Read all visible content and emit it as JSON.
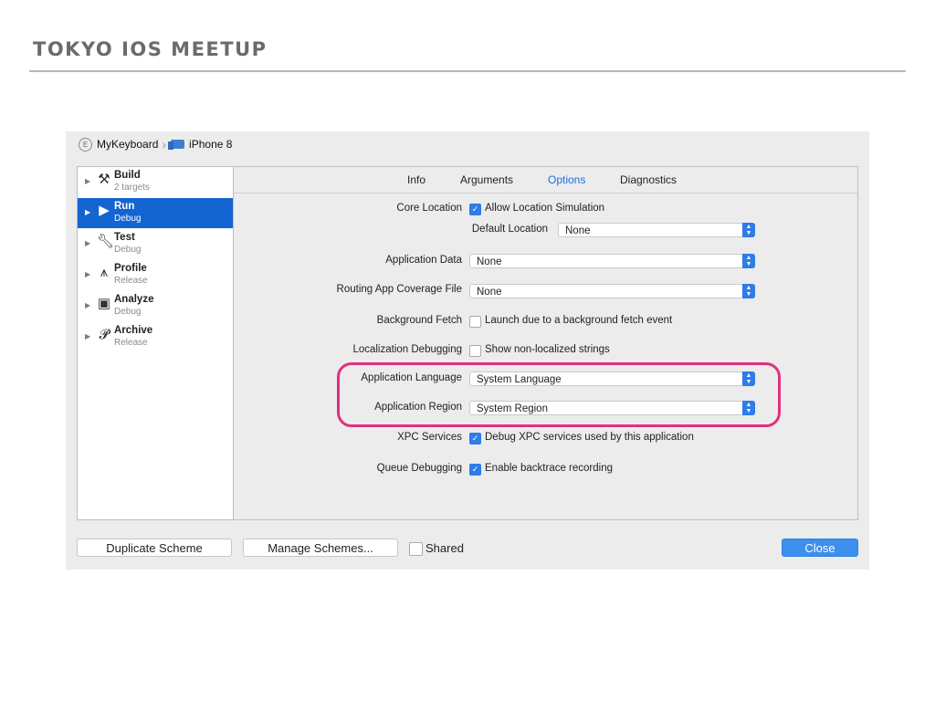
{
  "slide": {
    "title": "TOKYO IOS MEETUP"
  },
  "breadcrumb": {
    "scheme": "MyKeyboard",
    "device": "iPhone 8"
  },
  "sidebar": {
    "items": [
      {
        "label": "Build",
        "sub": "2 targets",
        "icon": "hammer-icon",
        "selected": false
      },
      {
        "label": "Run",
        "sub": "Debug",
        "icon": "play-icon",
        "selected": true
      },
      {
        "label": "Test",
        "sub": "Debug",
        "icon": "wrench-icon",
        "selected": false
      },
      {
        "label": "Profile",
        "sub": "Release",
        "icon": "instruments-icon",
        "selected": false
      },
      {
        "label": "Analyze",
        "sub": "Debug",
        "icon": "analyze-icon",
        "selected": false
      },
      {
        "label": "Archive",
        "sub": "Release",
        "icon": "archive-icon",
        "selected": false
      }
    ]
  },
  "tabs": [
    "Info",
    "Arguments",
    "Options",
    "Diagnostics"
  ],
  "active_tab": "Options",
  "options": {
    "core_location": {
      "label": "Core Location",
      "checkbox": "Allow Location Simulation",
      "checked": true
    },
    "default_location": {
      "label": "Default Location",
      "value": "None"
    },
    "application_data": {
      "label": "Application Data",
      "value": "None"
    },
    "routing_coverage": {
      "label": "Routing App Coverage File",
      "value": "None"
    },
    "background_fetch": {
      "label": "Background Fetch",
      "checkbox": "Launch due to a background fetch event",
      "checked": false
    },
    "localization_debugging": {
      "label": "Localization Debugging",
      "checkbox": "Show non-localized strings",
      "checked": false
    },
    "application_language": {
      "label": "Application Language",
      "value": "System Language"
    },
    "application_region": {
      "label": "Application Region",
      "value": "System Region"
    },
    "xpc_services": {
      "label": "XPC Services",
      "checkbox": "Debug XPC services used by this application",
      "checked": true
    },
    "queue_debugging": {
      "label": "Queue Debugging",
      "checkbox": "Enable backtrace recording",
      "checked": true
    }
  },
  "footer": {
    "duplicate": "Duplicate Scheme",
    "manage": "Manage Schemes...",
    "shared": "Shared",
    "shared_checked": false,
    "close": "Close"
  },
  "colors": {
    "highlight": "#e0307e",
    "accent": "#1464d2",
    "checkbox": "#2d7ce8"
  }
}
